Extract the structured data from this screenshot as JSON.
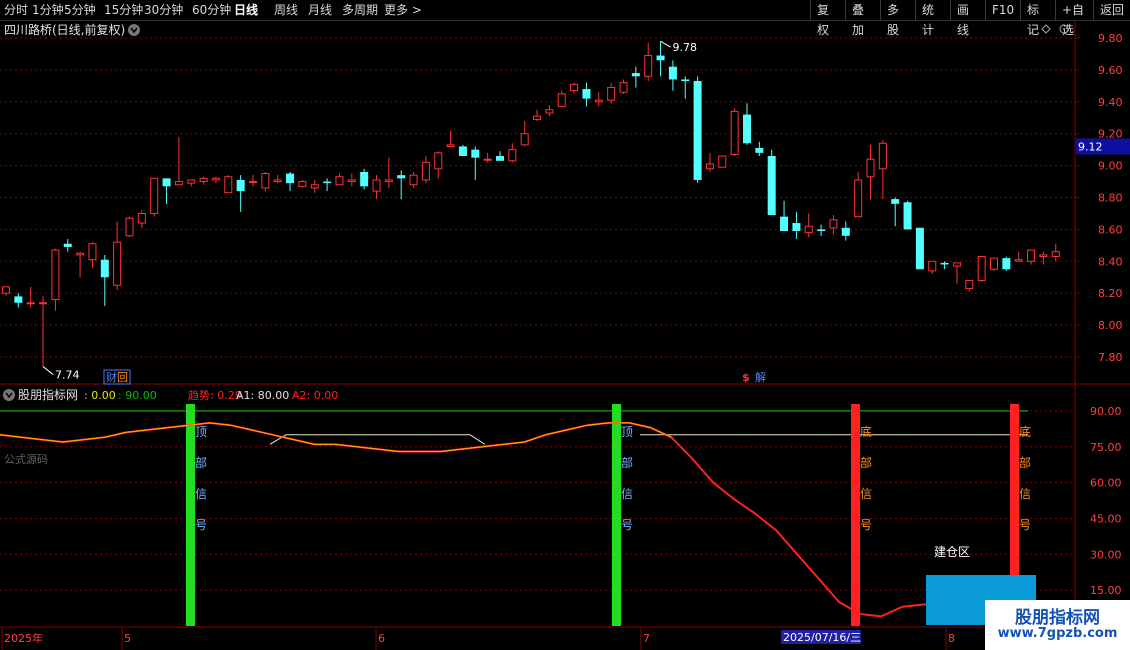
{
  "toolbar": {
    "left_items": [
      "分时",
      "1分钟",
      "5分钟",
      "15分钟",
      "30分钟",
      "60分钟",
      "日线",
      "周线",
      "月线",
      "多周期",
      "更多 >"
    ],
    "active": "日线",
    "right_items": [
      "复权",
      "叠加",
      "多股",
      "统计",
      "画线",
      "F10",
      "标记",
      "+自选",
      "返回"
    ]
  },
  "main_chart": {
    "title": "四川路桥(日线,前复权)",
    "y_ticks": [
      "9.80",
      "9.60",
      "9.40",
      "9.20",
      "9.00",
      "8.80",
      "8.60",
      "8.40",
      "8.20",
      "8.00",
      "7.80"
    ],
    "current_price_tag": "9.12",
    "high_label": "9.78",
    "low_label": "7.74",
    "markers": {
      "finance": "财",
      "report": "回",
      "lift": "解"
    }
  },
  "candles": [
    [
      8.2,
      8.24,
      8.18,
      8.24
    ],
    [
      8.18,
      8.2,
      8.11,
      8.14
    ],
    [
      8.14,
      8.24,
      8.11,
      8.14
    ],
    [
      8.14,
      8.18,
      7.74,
      8.14
    ],
    [
      8.16,
      8.48,
      8.09,
      8.47
    ],
    [
      8.51,
      8.54,
      8.46,
      8.49
    ],
    [
      8.44,
      8.46,
      8.3,
      8.45
    ],
    [
      8.41,
      8.52,
      8.36,
      8.51
    ],
    [
      8.41,
      8.44,
      8.12,
      8.3
    ],
    [
      8.25,
      8.65,
      8.22,
      8.52
    ],
    [
      8.56,
      8.68,
      8.55,
      8.67
    ],
    [
      8.64,
      8.72,
      8.61,
      8.7
    ],
    [
      8.7,
      8.92,
      8.68,
      8.92
    ],
    [
      8.92,
      8.92,
      8.76,
      8.87
    ],
    [
      8.88,
      9.18,
      8.88,
      8.9
    ],
    [
      8.89,
      8.91,
      8.87,
      8.91
    ],
    [
      8.9,
      8.93,
      8.88,
      8.92
    ],
    [
      8.91,
      8.93,
      8.89,
      8.92
    ],
    [
      8.83,
      8.94,
      8.83,
      8.93
    ],
    [
      8.91,
      8.94,
      8.71,
      8.84
    ],
    [
      8.9,
      8.94,
      8.87,
      8.9
    ],
    [
      8.86,
      8.96,
      8.84,
      8.95
    ],
    [
      8.9,
      8.94,
      8.89,
      8.91
    ],
    [
      8.95,
      8.96,
      8.84,
      8.89
    ],
    [
      8.87,
      8.91,
      8.86,
      8.9
    ],
    [
      8.86,
      8.91,
      8.83,
      8.88
    ],
    [
      8.9,
      8.92,
      8.84,
      8.89
    ],
    [
      8.88,
      8.95,
      8.88,
      8.93
    ],
    [
      8.9,
      8.95,
      8.87,
      8.91
    ],
    [
      8.96,
      8.98,
      8.85,
      8.87
    ],
    [
      8.84,
      8.94,
      8.79,
      8.91
    ],
    [
      8.9,
      9.05,
      8.86,
      8.91
    ],
    [
      8.94,
      8.97,
      8.79,
      8.92
    ],
    [
      8.88,
      8.96,
      8.86,
      8.94
    ],
    [
      8.91,
      9.06,
      8.89,
      9.02
    ],
    [
      8.98,
      9.09,
      8.92,
      9.08
    ],
    [
      9.12,
      9.22,
      9.12,
      9.13
    ],
    [
      9.12,
      9.13,
      9.09,
      9.06
    ],
    [
      9.1,
      9.12,
      8.91,
      9.05
    ],
    [
      9.04,
      9.08,
      9.02,
      9.04
    ],
    [
      9.06,
      9.09,
      9.04,
      9.03
    ],
    [
      9.03,
      9.14,
      9.02,
      9.1
    ],
    [
      9.13,
      9.28,
      9.12,
      9.2
    ],
    [
      9.29,
      9.35,
      9.28,
      9.31
    ],
    [
      9.33,
      9.38,
      9.31,
      9.35
    ],
    [
      9.37,
      9.47,
      9.37,
      9.45
    ],
    [
      9.47,
      9.52,
      9.45,
      9.51
    ],
    [
      9.48,
      9.52,
      9.37,
      9.42
    ],
    [
      9.4,
      9.46,
      9.37,
      9.41
    ],
    [
      9.41,
      9.52,
      9.39,
      9.49
    ],
    [
      9.46,
      9.54,
      9.45,
      9.52
    ],
    [
      9.58,
      9.62,
      9.49,
      9.56
    ],
    [
      9.56,
      9.77,
      9.53,
      9.69
    ],
    [
      9.69,
      9.78,
      9.56,
      9.66
    ],
    [
      9.62,
      9.66,
      9.47,
      9.54
    ],
    [
      9.54,
      9.56,
      9.42,
      9.53
    ],
    [
      9.53,
      9.56,
      8.89,
      8.91
    ],
    [
      8.98,
      9.08,
      8.96,
      9.01
    ],
    [
      8.99,
      9.06,
      8.99,
      9.06
    ],
    [
      9.07,
      9.36,
      9.06,
      9.34
    ],
    [
      9.32,
      9.39,
      9.13,
      9.14
    ],
    [
      9.11,
      9.15,
      9.06,
      9.08
    ],
    [
      9.06,
      9.1,
      8.71,
      8.69
    ],
    [
      8.68,
      8.78,
      8.63,
      8.59
    ],
    [
      8.64,
      8.71,
      8.54,
      8.59
    ],
    [
      8.58,
      8.7,
      8.55,
      8.62
    ],
    [
      8.6,
      8.63,
      8.56,
      8.59
    ],
    [
      8.61,
      8.69,
      8.57,
      8.66
    ],
    [
      8.61,
      8.65,
      8.53,
      8.56
    ],
    [
      8.68,
      8.96,
      8.68,
      8.91
    ],
    [
      8.93,
      9.13,
      8.79,
      9.04
    ],
    [
      8.98,
      9.16,
      8.79,
      9.14
    ],
    [
      8.79,
      8.8,
      8.62,
      8.76
    ],
    [
      8.77,
      8.78,
      8.6,
      8.6
    ],
    [
      8.61,
      8.61,
      8.36,
      8.35
    ],
    [
      8.34,
      8.39,
      8.32,
      8.4
    ],
    [
      8.39,
      8.4,
      8.35,
      8.38
    ],
    [
      8.37,
      8.38,
      8.26,
      8.39
    ],
    [
      8.23,
      8.27,
      8.21,
      8.28
    ],
    [
      8.28,
      8.41,
      8.27,
      8.43
    ],
    [
      8.35,
      8.41,
      8.34,
      8.42
    ],
    [
      8.42,
      8.43,
      8.34,
      8.35
    ],
    [
      8.4,
      8.46,
      8.4,
      8.41
    ],
    [
      8.4,
      8.42,
      8.38,
      8.47
    ],
    [
      8.43,
      8.46,
      8.38,
      8.44
    ],
    [
      8.43,
      8.51,
      8.4,
      8.46
    ]
  ],
  "indicator": {
    "title": "股朋指标网",
    "values": [
      {
        "text": ": 0.00",
        "color": "#e8e800"
      },
      {
        "text": ": 90.00",
        "color": "#00c000"
      },
      {
        "text": "趋势: 0.29",
        "color": "#ff2020"
      },
      {
        "text": "A1: 80.00",
        "color": "#e0e0e0"
      },
      {
        "text": "A2: 0.00",
        "color": "#ff2020"
      }
    ],
    "y_ticks": [
      "90.00",
      "75.00",
      "60.00",
      "45.00",
      "30.00",
      "15.00"
    ],
    "formula_label": "公式源码",
    "top_signal": [
      "顶",
      "部",
      "信",
      "号"
    ],
    "bottom_signal": [
      "底",
      "部",
      "信",
      "号"
    ],
    "buy_zone_label": "建仓区",
    "trend_series": [
      80,
      79,
      78,
      77,
      78,
      79,
      81,
      82,
      83,
      84,
      85,
      84,
      82,
      80,
      78,
      76,
      76,
      75,
      74,
      73,
      73,
      73,
      74,
      75,
      76,
      77,
      80,
      82,
      84,
      85,
      85,
      83,
      79,
      70,
      60,
      53,
      47,
      40,
      30,
      20,
      10,
      5,
      4,
      8,
      9,
      9,
      7,
      5,
      3,
      3
    ]
  },
  "time_axis": {
    "labels": [
      "2025年",
      "5",
      "6",
      "7",
      "8"
    ],
    "cursor_date": "2025/07/16/三"
  },
  "colors": {
    "up": "#ff3232",
    "down": "#54ffff",
    "grid": "#8b0000",
    "top_bar": "#22dd22",
    "bottom_bar": "#ff2020",
    "buy_zone": "#0a9ad8"
  },
  "brand": {
    "name": "股朋指标网",
    "url": "www.7gpzb.com"
  }
}
